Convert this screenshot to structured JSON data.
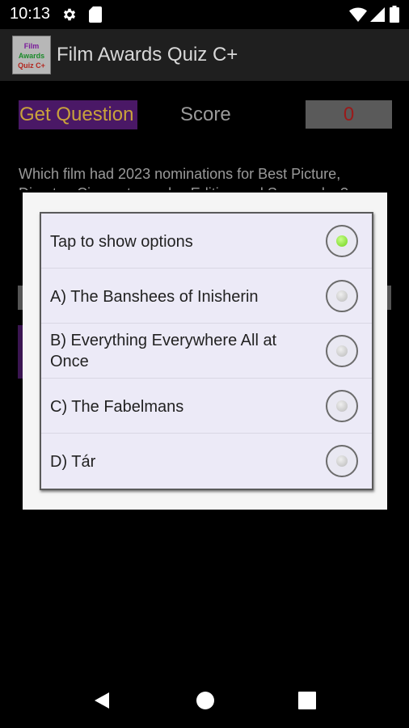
{
  "status_bar": {
    "time": "10:13",
    "icons": [
      "gear-icon",
      "sd-card-icon",
      "wifi-icon",
      "cell-signal-icon",
      "battery-icon"
    ]
  },
  "action_bar": {
    "logo_lines": [
      "Film",
      "Awards",
      "Quiz C+"
    ],
    "title": "Film Awards Quiz C+"
  },
  "main": {
    "get_question_label": "Get Question",
    "score_label": "Score",
    "score_value": "0",
    "question_text": "Which film had 2023 nominations for Best Picture, Director, Cinematography, Editing and Screenplay?"
  },
  "dialog": {
    "options": [
      {
        "label": "Tap to show options",
        "selected": true
      },
      {
        "label": "A) The Banshees of Inisherin",
        "selected": false
      },
      {
        "label": "B) Everything Everywhere All at Once",
        "selected": false
      },
      {
        "label": "C) The Fabelmans",
        "selected": false
      },
      {
        "label": "D) Tár",
        "selected": false
      }
    ]
  },
  "colors": {
    "radio_selected": "#6fd21a",
    "get_question_bg": "#4a1866",
    "get_question_text": "#c9a23b",
    "score_value": "#9a1a1a"
  },
  "nav_bar": {
    "icons": [
      "back-icon",
      "home-icon",
      "recents-icon"
    ]
  }
}
